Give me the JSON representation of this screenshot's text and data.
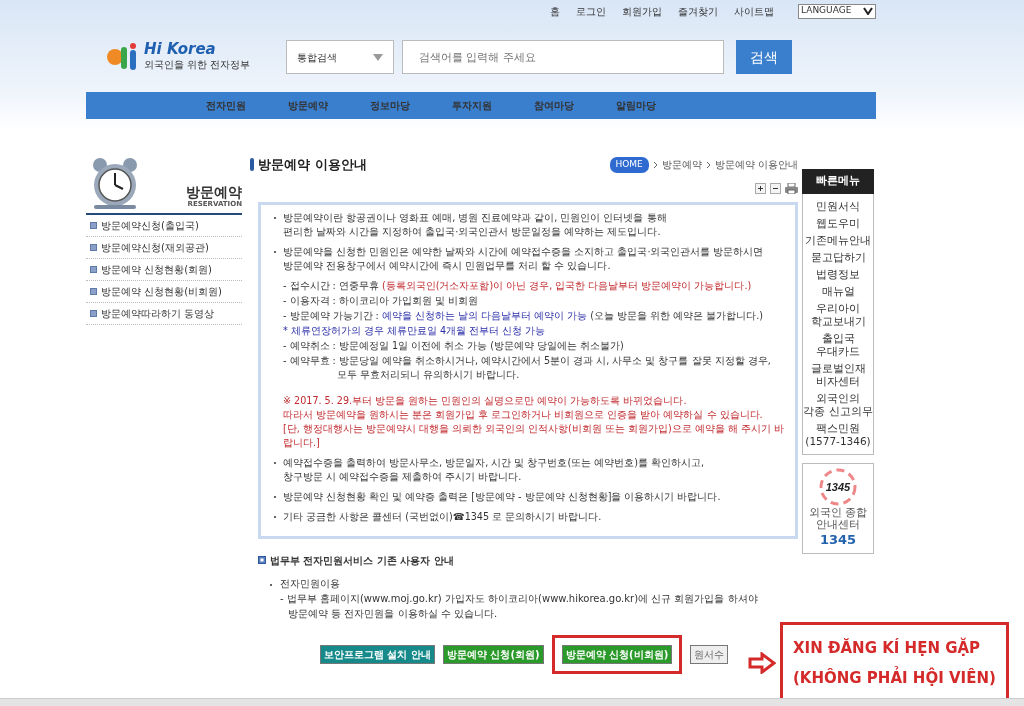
{
  "top_links": [
    "홈",
    "로그인",
    "회원가입",
    "즐겨찾기",
    "사이트맵"
  ],
  "language_select": {
    "value": "LANGUAGE"
  },
  "logo": {
    "text": "Hi Korea",
    "tagline": "외국인을 위한 전자정부"
  },
  "search": {
    "category": "통합검색",
    "placeholder": "검색어를 입력해 주세요",
    "button": "검색"
  },
  "nav": [
    "전자민원",
    "방문예약",
    "정보마당",
    "투자지원",
    "참여마당",
    "알림마당"
  ],
  "sidebar": {
    "title": "방문예약",
    "subtitle": "RESERVATION",
    "items": [
      "방문예약신청(출입국)",
      "방문예약신청(재외공관)",
      "방문예약 신청현황(회원)",
      "방문예약 신청현황(비회원)",
      "방문예약따라하기 동영상"
    ]
  },
  "page_title": "방문예약 이용안내",
  "breadcrumb": [
    "HOME",
    "방문예약",
    "방문예약 이용안내"
  ],
  "info_blocks": [
    {
      "kind": "bullet",
      "lines": [
        [
          {
            "text": "방문예약이란 항공권이나 영화표 예매, 병원 진료예약과 같이, 민원인이 인터넷을 통해"
          }
        ],
        [
          {
            "text": "편리한 날짜와 시간을 지정하여 출입국·외국인관서 방문일정을 예약하는 제도입니다."
          }
        ]
      ]
    },
    {
      "kind": "bullet",
      "lines": [
        [
          {
            "text": "방문예약을 신청한 민원인은 예약한 날짜와 시간에 예약접수증을 소지하고 출입국·외국인관서를 방문하시면"
          }
        ],
        [
          {
            "text": "방문예약 전용창구에서 예약시간에 즉시 민원업무를 처리 할 수 있습니다."
          }
        ]
      ]
    },
    {
      "kind": "detail",
      "lines": [
        [
          {
            "text": "- 접수시간 : 연중무휴 "
          },
          {
            "text": "(등록외국인(거소자포함)이 아닌 경우, 입국한 다음날부터 방문예약이 가능합니다.)",
            "alert": true
          }
        ]
      ]
    },
    {
      "kind": "detail",
      "lines": [
        [
          {
            "text": "- 이용자격 : 하이코리아 가입회원 및 비회원"
          }
        ]
      ]
    },
    {
      "kind": "detail",
      "lines": [
        [
          {
            "text": "- 방문예약 가능기간 : "
          },
          {
            "text": "예약을 신청하는 날의 다음날부터 예약이 가능",
            "emphasis": true
          },
          {
            "text": " (오늘 방문을 위한 예약은 불가합니다.)"
          }
        ]
      ]
    },
    {
      "kind": "detail",
      "lines": [
        [
          {
            "text": "* 체류연장허가의 경우 체류만료일 4개월 전부터 신청 가능",
            "emphasis": true
          }
        ]
      ]
    },
    {
      "kind": "detail",
      "lines": [
        [
          {
            "text": "- 예약취소 : 방문예정일 1일 이전에 취소 가능 (방문예약 당일에는 취소불가)"
          }
        ]
      ]
    },
    {
      "kind": "detail",
      "lines": [
        [
          {
            "text": "- 예약무효 : 방문당일 예약을 취소하시거나, 예약시간에서 5분이 경과 시, 사무소 및 창구를 잘못 지정할 경우,"
          }
        ],
        [
          {
            "text": "모두 무효처리되니 유의하시기 바랍니다."
          }
        ]
      ]
    },
    {
      "kind": "notice",
      "lines": [
        [
          {
            "text": "※ 2017. 5. 29.부터 방문을 원하는 민원인의 실명으로만 예약이 가능하도록 바뀌었습니다."
          }
        ],
        [
          {
            "text": "따라서 방문예약을 원하시는 분은 회원가입 후 로그인하거나 비회원으로 인증을 받아 예약하실 수 있습니다."
          }
        ],
        [
          {
            "text": "[단, 행정대행사는 방문예약시 대행을 의뢰한 외국인의 인적사항(비회원 또는 회원가입)으로 예약을 해 주시기 바랍니다.]"
          }
        ]
      ]
    },
    {
      "kind": "bullet",
      "lines": [
        [
          {
            "text": "예약접수증을 출력하여 방문사무소, 방문일자, 시간 및 창구번호(또는 예약번호)를 확인하시고,"
          }
        ],
        [
          {
            "text": "창구방문 시 예약접수증을 제출하여 주시기 바랍니다."
          }
        ]
      ]
    },
    {
      "kind": "bullet",
      "lines": [
        [
          {
            "text": "방문예약 신청현황 확인 및 예약증 출력은 [방문예약 - 방문예약 신청현황]을 이용하시기 바랍니다."
          }
        ]
      ]
    },
    {
      "kind": "bullet",
      "lines": [
        [
          {
            "text": "기타 궁금한 사항은 콜센터 (국번없이)☎1345 로 문의하시기 바랍니다."
          }
        ]
      ]
    }
  ],
  "notice_section": {
    "title": "법무부 전자민원서비스 기존 사용자 안내",
    "bullet": "전자민원이용",
    "lines": [
      "- 법무부 홈페이지(www.moj.go.kr) 가입자도 하이코리아(www.hikorea.go.kr)에 신규 회원가입을 하셔야",
      "방문예약 등 전자민원을 이용하실 수 있습니다."
    ]
  },
  "buttons": [
    {
      "label": "보안프로그램 설치 안내",
      "kind": "teal",
      "highlighted": false
    },
    {
      "label": "방문예약 신청(회원)",
      "kind": "green",
      "highlighted": false
    },
    {
      "label": "방문예약 신청(비회원)",
      "kind": "green",
      "highlighted": true
    },
    {
      "label": "원서수",
      "kind": "gray",
      "highlighted": false
    }
  ],
  "annotation": {
    "lines": [
      "XIN ĐĂNG KÍ HẸN GẶP",
      "(KHÔNG PHẢI HỘI VIÊN)"
    ]
  },
  "quick_menu": {
    "title": "빠른메뉴",
    "items": [
      "민원서식",
      "웹도우미",
      "기존메뉴안내",
      "묻고답하기",
      "법령정보",
      "매뉴얼",
      "우리아이\n학교보내기",
      "출입국\n우대카드",
      "글로벌인재\n비자센터",
      "외국인의\n각종 신고의무",
      "팩스민원\n(1577-1346)"
    ]
  },
  "call_center": {
    "logo_number": "1345",
    "label": "외국인 종합\n안내센터",
    "number": "1345"
  }
}
